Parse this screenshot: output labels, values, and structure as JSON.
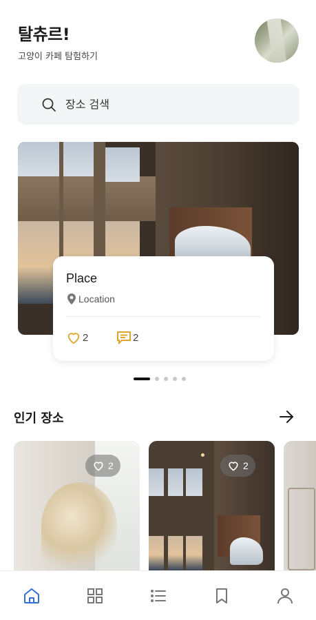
{
  "header": {
    "title": "탈츄르!",
    "subtitle": "고양이 카페 탐험하기"
  },
  "search": {
    "placeholder": "장소 검색"
  },
  "featured": {
    "name": "Place",
    "location": "Location",
    "likes": "2",
    "comments": "2"
  },
  "carousel": {
    "total": 5,
    "active": 1
  },
  "popular": {
    "title": "인기 장소",
    "items": [
      {
        "likes": "2"
      },
      {
        "likes": "2"
      }
    ]
  },
  "tabs": [
    "home",
    "grid",
    "list",
    "bookmark",
    "profile"
  ],
  "colors": {
    "accent": "#2f6fd6",
    "stat_icon": "#e0a52f",
    "text": "#1a1a1a"
  }
}
